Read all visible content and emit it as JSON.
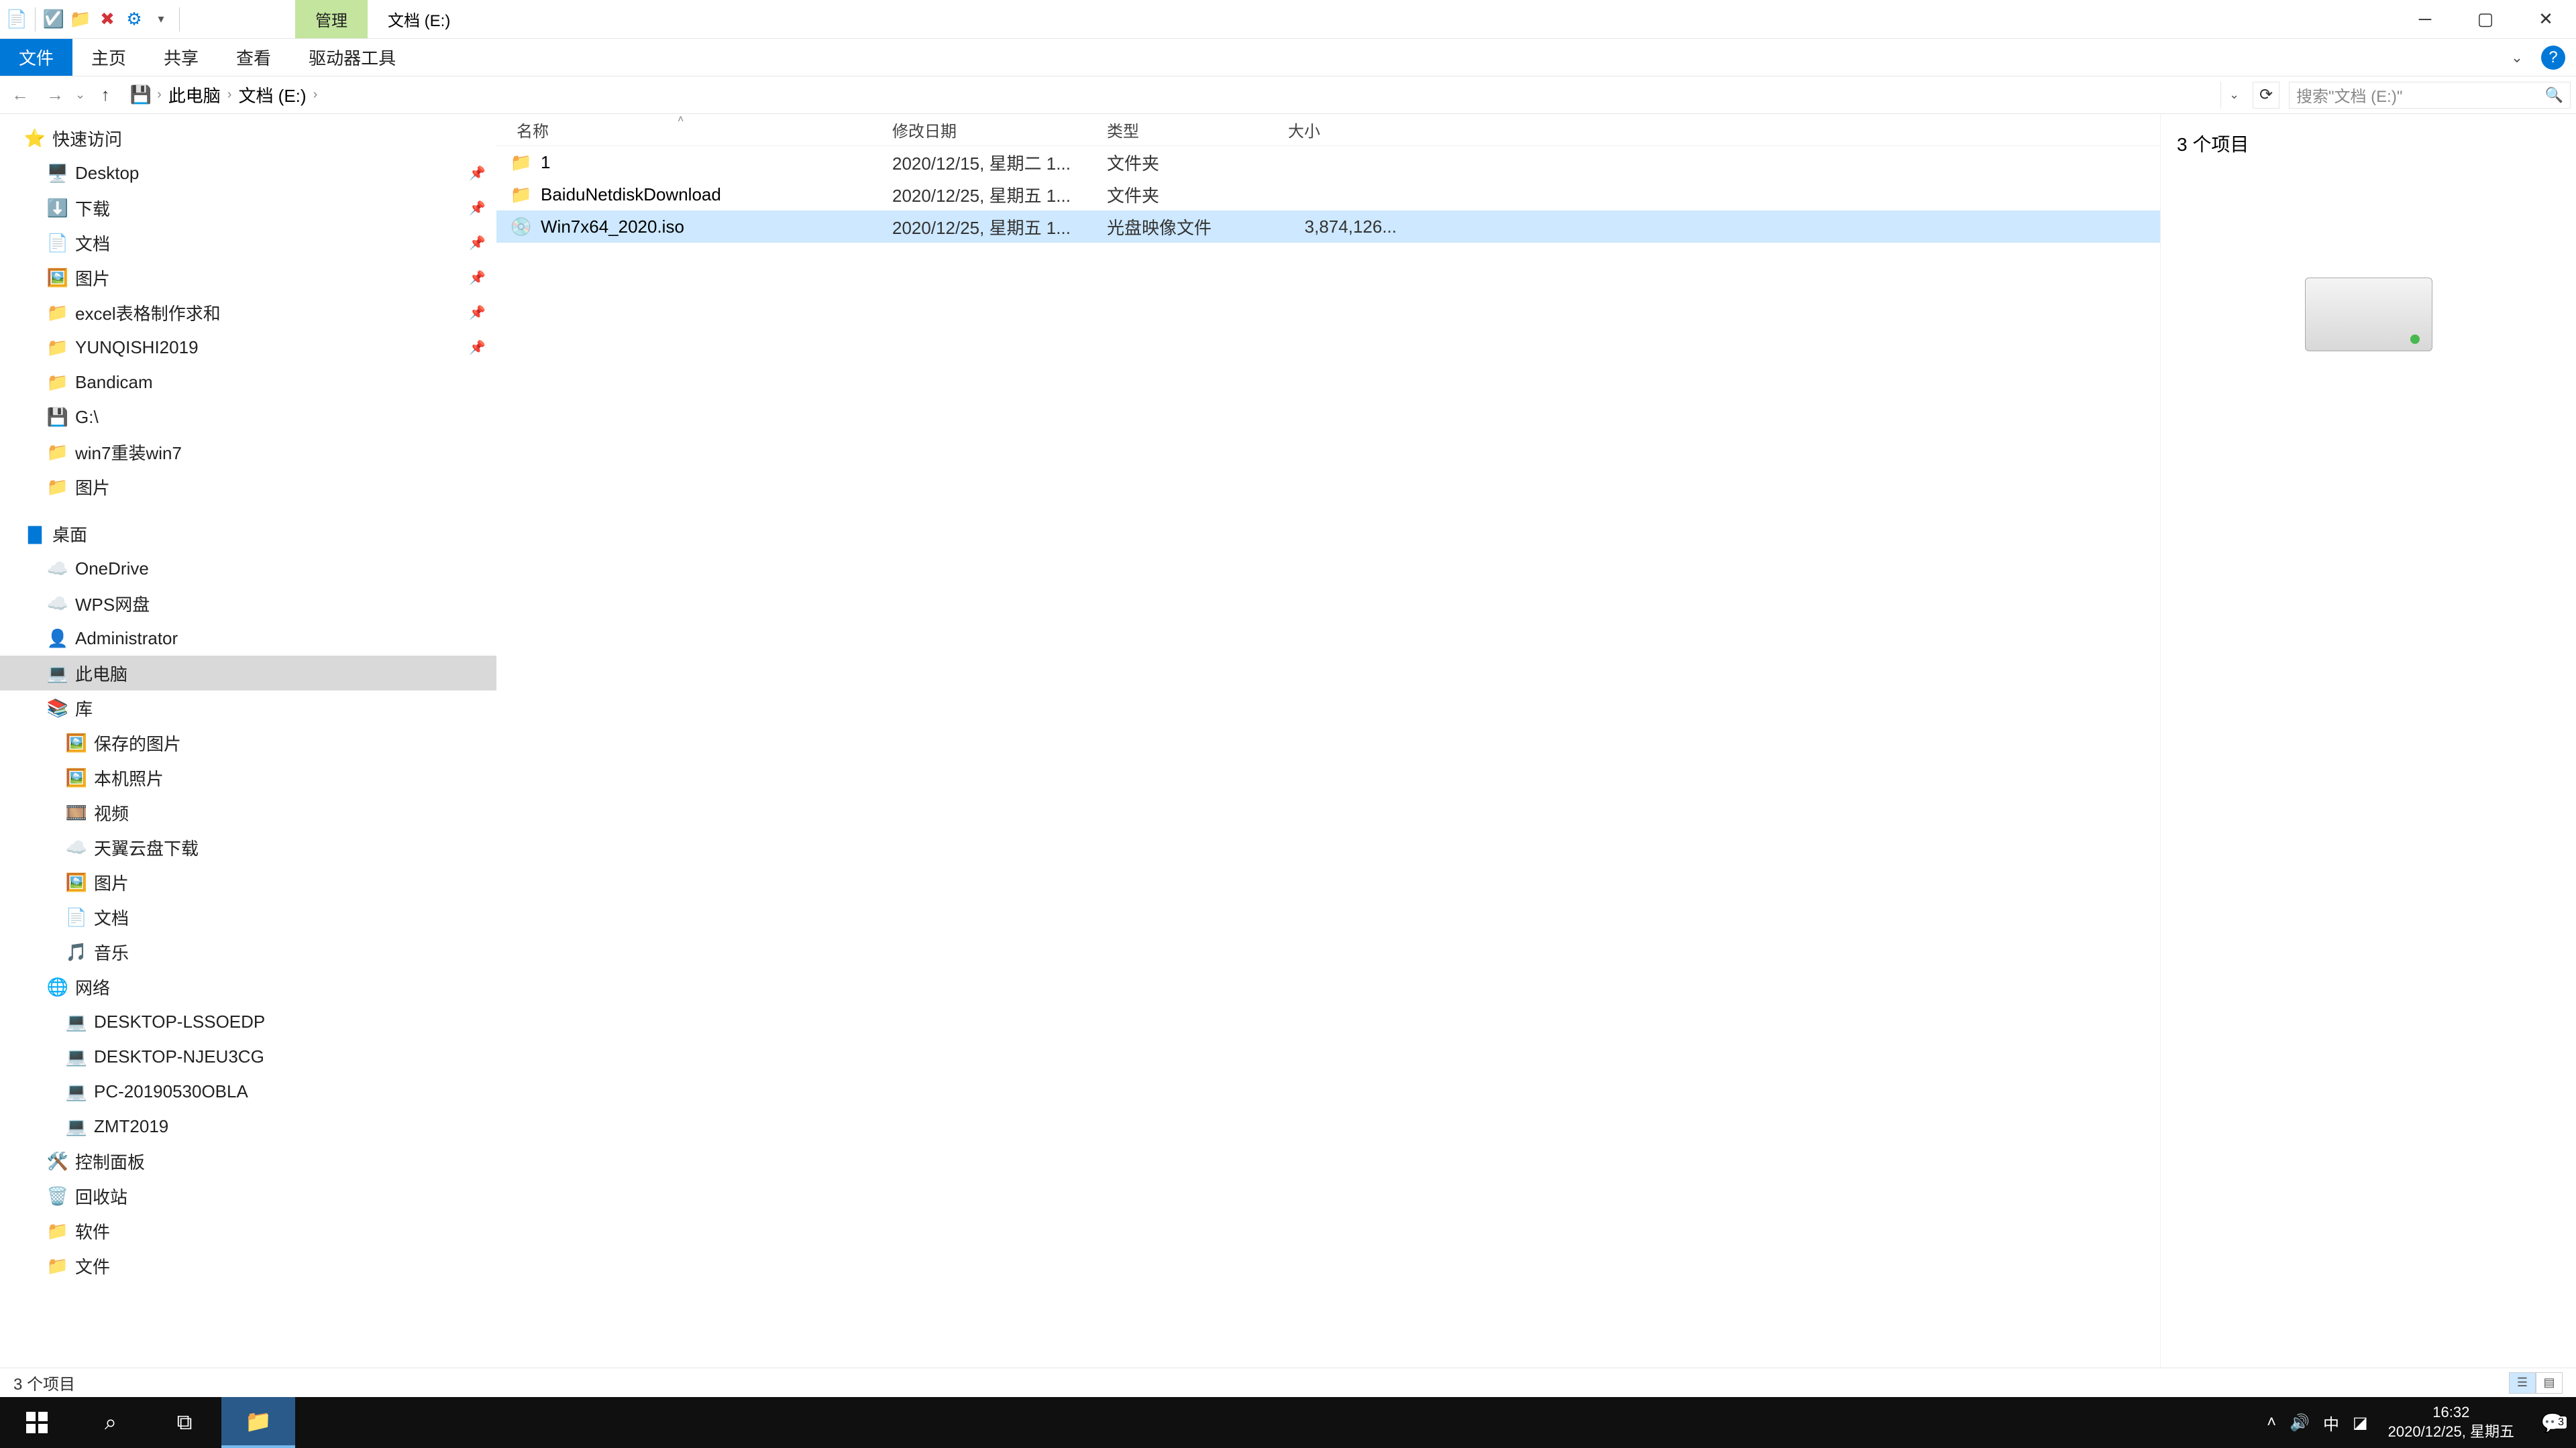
{
  "title": {
    "context_tab": "管理",
    "location": "文档 (E:)"
  },
  "ribbon": {
    "file": "文件",
    "home": "主页",
    "share": "共享",
    "view": "查看",
    "drive_tools": "驱动器工具"
  },
  "addr": {
    "crumb_pc": "此电脑",
    "crumb_drive": "文档 (E:)",
    "search_placeholder": "搜索\"文档 (E:)\""
  },
  "nav": {
    "quick": "快速访问",
    "quick_items": [
      {
        "label": "Desktop",
        "icon": "🖥️",
        "pin": true
      },
      {
        "label": "下载",
        "icon": "⬇️",
        "pin": true
      },
      {
        "label": "文档",
        "icon": "📄",
        "pin": true
      },
      {
        "label": "图片",
        "icon": "🖼️",
        "pin": true
      },
      {
        "label": "excel表格制作求和",
        "icon": "📁",
        "pin": true
      },
      {
        "label": "YUNQISHI2019",
        "icon": "📁",
        "pin": true
      },
      {
        "label": "Bandicam",
        "icon": "📁",
        "pin": false
      },
      {
        "label": "G:\\",
        "icon": "💾",
        "pin": false
      },
      {
        "label": "win7重装win7",
        "icon": "📁",
        "pin": false
      },
      {
        "label": "图片",
        "icon": "📁",
        "pin": false
      }
    ],
    "desktop": "桌面",
    "desktop_items": [
      {
        "label": "OneDrive",
        "icon": "☁️"
      },
      {
        "label": "WPS网盘",
        "icon": "☁️"
      },
      {
        "label": "Administrator",
        "icon": "👤"
      },
      {
        "label": "此电脑",
        "icon": "💻",
        "selected": true
      },
      {
        "label": "库",
        "icon": "📚"
      }
    ],
    "lib_items": [
      {
        "label": "保存的图片",
        "icon": "🖼️"
      },
      {
        "label": "本机照片",
        "icon": "🖼️"
      },
      {
        "label": "视频",
        "icon": "🎞️"
      },
      {
        "label": "天翼云盘下载",
        "icon": "☁️"
      },
      {
        "label": "图片",
        "icon": "🖼️"
      },
      {
        "label": "文档",
        "icon": "📄"
      },
      {
        "label": "音乐",
        "icon": "🎵"
      }
    ],
    "network": "网络",
    "net_items": [
      {
        "label": "DESKTOP-LSSOEDP",
        "icon": "💻"
      },
      {
        "label": "DESKTOP-NJEU3CG",
        "icon": "💻"
      },
      {
        "label": "PC-20190530OBLA",
        "icon": "💻"
      },
      {
        "label": "ZMT2019",
        "icon": "💻"
      }
    ],
    "cpanel": "控制面板",
    "recycle": "回收站",
    "soft": "软件",
    "docs": "文件"
  },
  "cols": {
    "name": "名称",
    "date": "修改日期",
    "type": "类型",
    "size": "大小"
  },
  "rows": [
    {
      "icon": "📁",
      "name": "1",
      "date": "2020/12/15, 星期二 1...",
      "type": "文件夹",
      "size": ""
    },
    {
      "icon": "📁",
      "name": "BaiduNetdiskDownload",
      "date": "2020/12/25, 星期五 1...",
      "type": "文件夹",
      "size": ""
    },
    {
      "icon": "💿",
      "name": "Win7x64_2020.iso",
      "date": "2020/12/25, 星期五 1...",
      "type": "光盘映像文件",
      "size": "3,874,126...",
      "selected": true
    }
  ],
  "preview": {
    "count": "3 个项目"
  },
  "status": {
    "text": "3 个项目"
  },
  "tray": {
    "ime": "中",
    "time": "16:32",
    "date": "2020/12/25, 星期五",
    "notif": "3"
  }
}
